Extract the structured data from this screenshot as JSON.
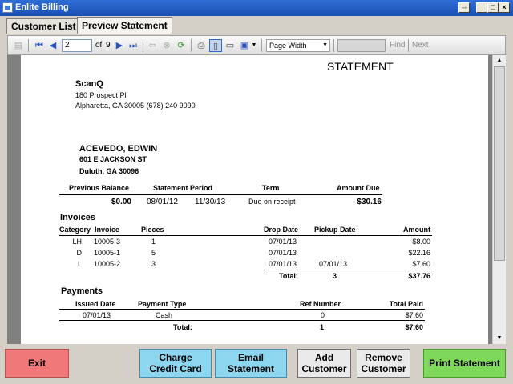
{
  "window": {
    "title": "Enlite Billing"
  },
  "tabs": [
    {
      "label": "Customer List"
    },
    {
      "label": "Preview Statement"
    }
  ],
  "toolbar": {
    "page_current": "2",
    "page_of": "of",
    "page_total": "9",
    "zoom": "Page Width",
    "find_label": "Find",
    "next_label": "Next"
  },
  "statement": {
    "heading": "STATEMENT",
    "company": {
      "name": "ScanQ",
      "address1": "180 Prospect Pl",
      "address2": "Alpharetta, GA 30005 (678) 240 9090"
    },
    "customer": {
      "name": "ACEVEDO, EDWIN",
      "address1": "601 E JACKSON ST",
      "address2": "Duluth, GA 30096"
    },
    "summary": {
      "headers": {
        "previous_balance": "Previous Balance",
        "statement_period": "Statement Period",
        "term": "Term",
        "amount_due": "Amount Due"
      },
      "previous_balance": "$0.00",
      "period_start": "08/01/12",
      "period_end": "11/30/13",
      "term": "Due on receipt",
      "amount_due": "$30.16"
    },
    "invoices": {
      "title": "Invoices",
      "headers": {
        "category": "Category",
        "invoice": "Invoice",
        "pieces": "Pieces",
        "drop_date": "Drop Date",
        "pickup_date": "Pickup Date",
        "amount": "Amount"
      },
      "rows": [
        {
          "category": "LH",
          "invoice": "10005-3",
          "pieces": "1",
          "drop_date": "07/01/13",
          "pickup_date": "",
          "amount": "$8.00"
        },
        {
          "category": "D",
          "invoice": "10005-1",
          "pieces": "5",
          "drop_date": "07/01/13",
          "pickup_date": "",
          "amount": "$22.16"
        },
        {
          "category": "L",
          "invoice": "10005-2",
          "pieces": "3",
          "drop_date": "07/01/13",
          "pickup_date": "07/01/13",
          "amount": "$7.60"
        }
      ],
      "total_label": "Total:",
      "total_pieces": "3",
      "total_amount": "$37.76"
    },
    "payments": {
      "title": "Payments",
      "headers": {
        "issued_date": "Issued Date",
        "payment_type": "Payment Type",
        "ref_number": "Ref Number",
        "total_paid": "Total Paid"
      },
      "rows": [
        {
          "issued_date": "07/01/13",
          "payment_type": "Cash",
          "ref_number": "0",
          "total_paid": "$7.60"
        }
      ],
      "total_label": "Total:",
      "total_count": "1",
      "total_paid": "$7.60"
    }
  },
  "buttons": {
    "exit": "Exit",
    "charge_line1": "Charge",
    "charge_line2": "Credit Card",
    "email_line1": "Email",
    "email_line2": "Statement",
    "add_line1": "Add",
    "add_line2": "Customer",
    "remove_line1": "Remove",
    "remove_line2": "Customer",
    "print": "Print Statement"
  },
  "colors": {
    "exit": "#f07878",
    "charge": "#8cd6f0",
    "email": "#8cd6f0",
    "add": "#eaeaea",
    "remove": "#eaeaea",
    "print": "#7ed85a"
  }
}
